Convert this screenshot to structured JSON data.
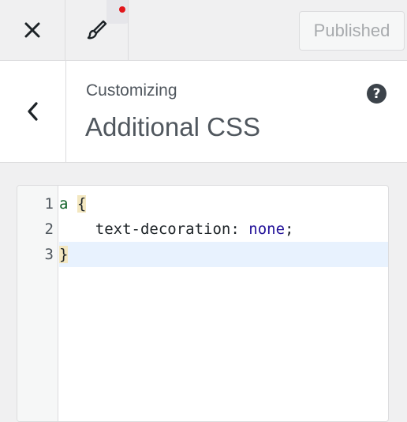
{
  "topbar": {
    "close_icon": "close-icon",
    "brush_icon": "paintbrush-icon",
    "notification_color": "#e2161b",
    "publish_label": "Published"
  },
  "header": {
    "back_icon": "chevron-left-icon",
    "eyebrow": "Customizing",
    "title": "Additional CSS",
    "help_symbol": "?"
  },
  "editor": {
    "lines": [
      {
        "number": "1",
        "selector": "a",
        "space": " ",
        "open_brace": "{"
      },
      {
        "number": "2",
        "indent": "    ",
        "property": "text-decoration:",
        "space": " ",
        "value": "none",
        "semicolon": ";"
      },
      {
        "number": "3",
        "close_brace": "}"
      }
    ],
    "active_line": 3
  }
}
